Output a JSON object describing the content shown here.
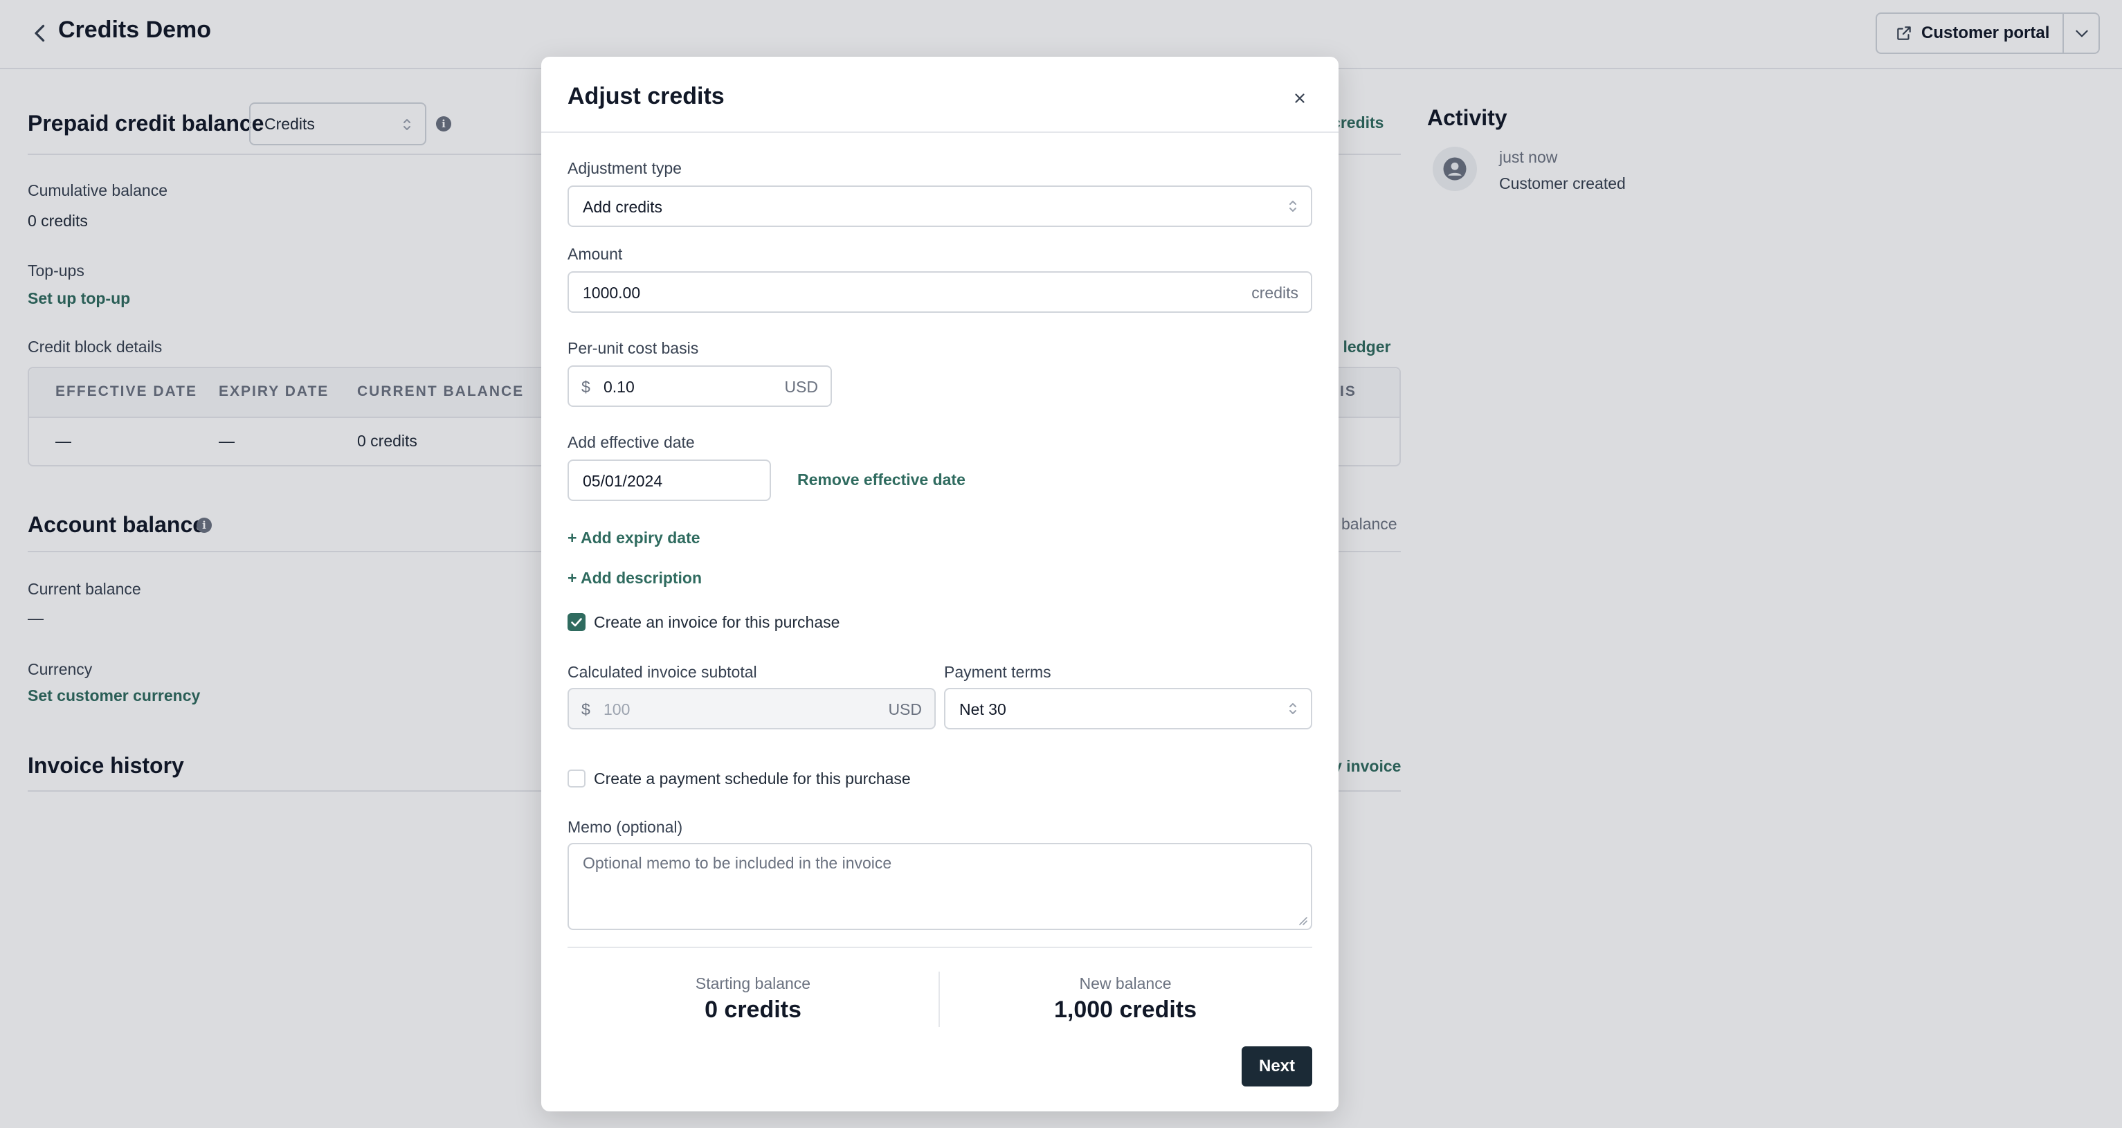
{
  "header": {
    "title": "Credits Demo",
    "customer_portal_label": "Customer portal"
  },
  "prepaid": {
    "title": "Prepaid credit balance",
    "unit_select": "Credits",
    "action_partial": "t credits",
    "cumulative_label": "Cumulative balance",
    "cumulative_value": "0 credits",
    "topups_label": "Top-ups",
    "topups_link": "Set up top-up",
    "block_details_label": "Credit block details",
    "ledger_partial": "it ledger",
    "table": {
      "columns": [
        "EFFECTIVE DATE",
        "EXPIRY DATE",
        "CURRENT BALANCE",
        "SIS"
      ],
      "row": [
        "—",
        "—",
        "0 credits"
      ]
    }
  },
  "account": {
    "title": "Account balance",
    "action_partial": "balance",
    "current_label": "Current balance",
    "current_value": "—",
    "currency_label": "Currency",
    "currency_link": "Set customer currency"
  },
  "invoices": {
    "title": "Invoice history",
    "action_partial": "v invoice"
  },
  "activity": {
    "title": "Activity",
    "items": [
      {
        "time": "just now",
        "text": "Customer created"
      }
    ]
  },
  "modal": {
    "title": "Adjust credits",
    "adjustment_type": {
      "label": "Adjustment type",
      "value": "Add credits"
    },
    "amount": {
      "label": "Amount",
      "value": "1000.00",
      "suffix": "credits"
    },
    "cost_basis": {
      "label": "Per-unit cost basis",
      "prefix": "$",
      "value": "0.10",
      "suffix": "USD"
    },
    "effective_date": {
      "label": "Add effective date",
      "value": "05/01/2024",
      "remove_link": "Remove effective date"
    },
    "add_expiry_link": "+ Add expiry date",
    "add_description_link": "+ Add description",
    "create_invoice": {
      "label": "Create an invoice for this purchase",
      "checked": true
    },
    "subtotal": {
      "label": "Calculated invoice subtotal",
      "prefix": "$",
      "value": "100",
      "suffix": "USD"
    },
    "payment_terms": {
      "label": "Payment terms",
      "value": "Net 30"
    },
    "payment_schedule": {
      "label": "Create a payment schedule for this purchase",
      "checked": false
    },
    "memo": {
      "label": "Memo (optional)",
      "placeholder": "Optional memo to be included in the invoice"
    },
    "summary": {
      "starting_label": "Starting balance",
      "starting_value": "0 credits",
      "new_label": "New balance",
      "new_value": "1,000 credits"
    },
    "next_label": "Next"
  },
  "colors": {
    "accent": "#2f6b5f",
    "primary_button": "#1b2a36",
    "overlay": "rgba(15,23,42,0.15)"
  }
}
